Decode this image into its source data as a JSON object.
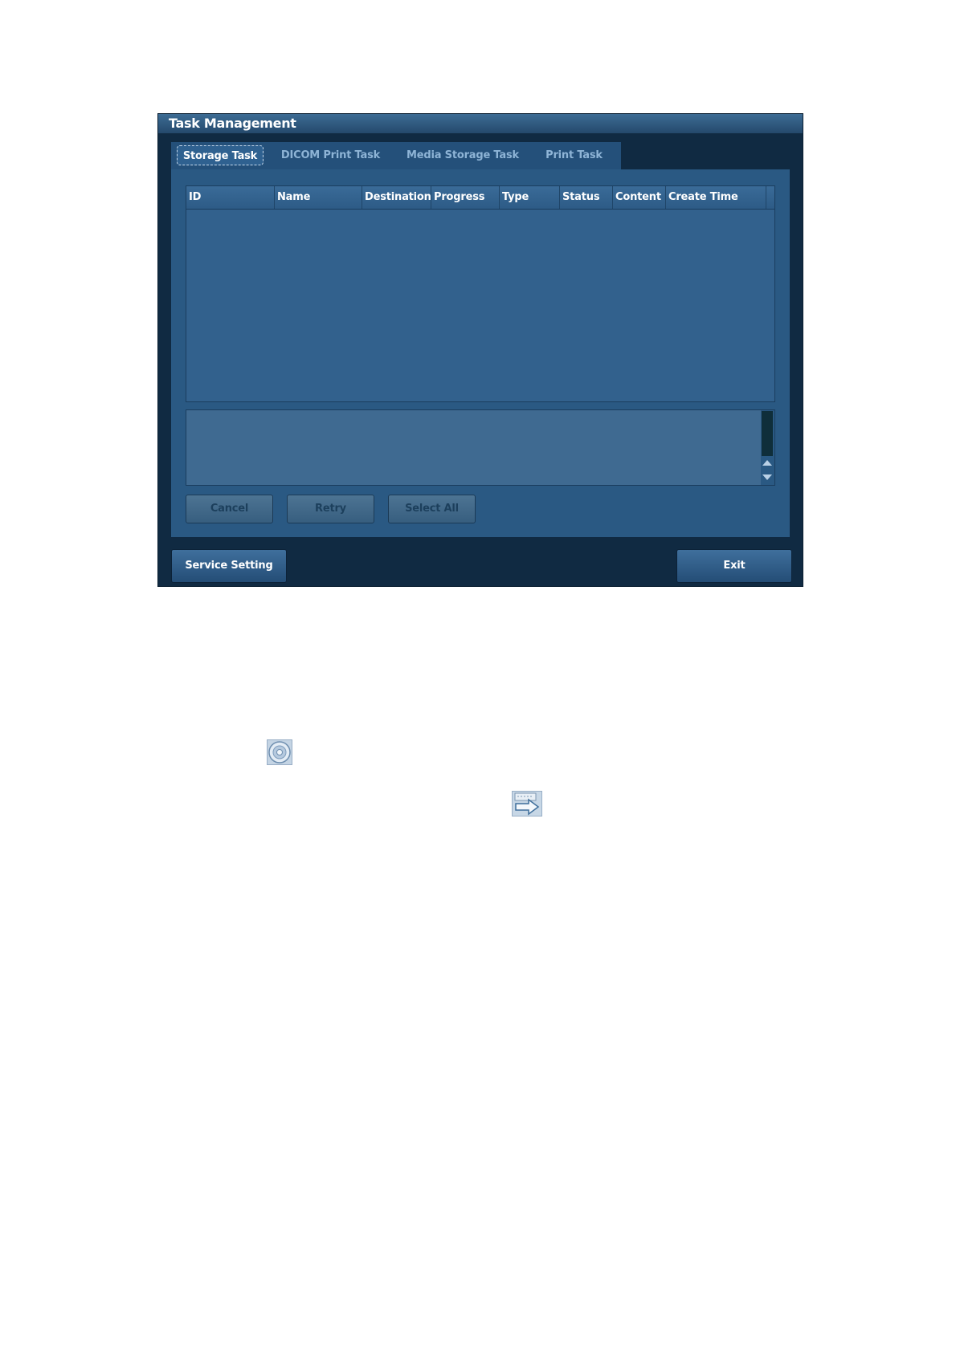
{
  "dialog": {
    "title": "Task Management",
    "tabs": [
      {
        "label": "Storage Task",
        "active": true
      },
      {
        "label": "DICOM Print Task",
        "active": false
      },
      {
        "label": "Media Storage Task",
        "active": false
      },
      {
        "label": "Print Task",
        "active": false
      }
    ],
    "table": {
      "columns": [
        "ID",
        "Name",
        "Destination",
        "Progress",
        "Type",
        "Status",
        "Content",
        "Create Time"
      ],
      "rows": []
    },
    "buttons": {
      "cancel": "Cancel",
      "retry": "Retry",
      "select_all": "Select All",
      "service_setting": "Service Setting",
      "exit": "Exit"
    }
  },
  "icons": {
    "disc": "disc-icon",
    "transfer": "send-arrow-icon"
  },
  "colors": {
    "dialog_bg": "#102a42",
    "panel_bg": "#2a5983",
    "grid_bg": "#32618d",
    "disabled_text": "#1c3f5c"
  }
}
